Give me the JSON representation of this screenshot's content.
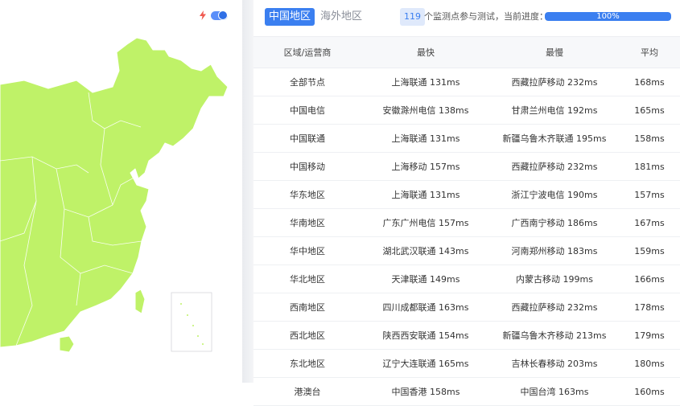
{
  "colors": {
    "accent": "#3b7ff0",
    "map_fill": "#bff268",
    "map_border": "#ffffff"
  },
  "map": {
    "toggle_icon": "lightning-icon",
    "toggle_state": "on"
  },
  "tabs": [
    {
      "label": "中国地区",
      "active": true
    },
    {
      "label": "海外地区",
      "active": false
    }
  ],
  "status": {
    "count": "119",
    "text": "个监测点参与测试，当前进度：",
    "progress": 100,
    "progress_label": "100%"
  },
  "table": {
    "headers": [
      "区域/运营商",
      "最快",
      "最慢",
      "平均"
    ],
    "rows": [
      [
        "全部节点",
        "上海联通 131ms",
        "西藏拉萨移动 232ms",
        "168ms"
      ],
      [
        "中国电信",
        "安徽滁州电信 138ms",
        "甘肃兰州电信 192ms",
        "165ms"
      ],
      [
        "中国联通",
        "上海联通 131ms",
        "新疆乌鲁木齐联通 195ms",
        "158ms"
      ],
      [
        "中国移动",
        "上海移动 157ms",
        "西藏拉萨移动 232ms",
        "181ms"
      ],
      [
        "华东地区",
        "上海联通 131ms",
        "浙江宁波电信 190ms",
        "157ms"
      ],
      [
        "华南地区",
        "广东广州电信 157ms",
        "广西南宁移动 186ms",
        "167ms"
      ],
      [
        "华中地区",
        "湖北武汉联通 143ms",
        "河南郑州移动 183ms",
        "159ms"
      ],
      [
        "华北地区",
        "天津联通 149ms",
        "内蒙古移动 199ms",
        "166ms"
      ],
      [
        "西南地区",
        "四川成都联通 163ms",
        "西藏拉萨移动 232ms",
        "178ms"
      ],
      [
        "西北地区",
        "陕西西安联通 154ms",
        "新疆乌鲁木齐移动 213ms",
        "179ms"
      ],
      [
        "东北地区",
        "辽宁大连联通 165ms",
        "吉林长春移动 203ms",
        "180ms"
      ],
      [
        "港澳台",
        "中国香港 158ms",
        "中国台湾 163ms",
        "160ms"
      ]
    ]
  }
}
